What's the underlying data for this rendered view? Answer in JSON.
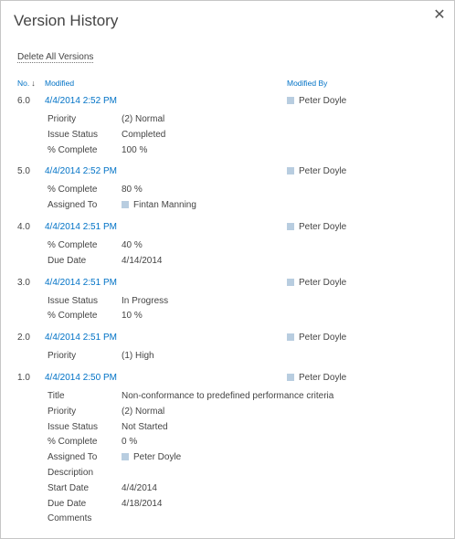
{
  "dialog": {
    "title": "Version History",
    "close_glyph": "✕",
    "delete_all_label": "Delete All Versions"
  },
  "columns": {
    "no": "No.",
    "sort_glyph": "↓",
    "modified": "Modified",
    "modified_by": "Modified By"
  },
  "colors": {
    "link": "#0072c6",
    "text": "#444444",
    "user_square": "#b8cde0"
  },
  "versions": [
    {
      "no": "6.0",
      "modified": "4/4/2014 2:52 PM",
      "modified_by": "Peter Doyle",
      "props": [
        {
          "label": "Priority",
          "value": "(2) Normal",
          "user": false
        },
        {
          "label": "Issue Status",
          "value": "Completed",
          "user": false
        },
        {
          "label": "% Complete",
          "value": "100 %",
          "user": false
        }
      ]
    },
    {
      "no": "5.0",
      "modified": "4/4/2014 2:52 PM",
      "modified_by": "Peter Doyle",
      "props": [
        {
          "label": "% Complete",
          "value": "80 %",
          "user": false
        },
        {
          "label": "Assigned To",
          "value": "Fintan Manning",
          "user": true
        }
      ]
    },
    {
      "no": "4.0",
      "modified": "4/4/2014 2:51 PM",
      "modified_by": "Peter Doyle",
      "props": [
        {
          "label": "% Complete",
          "value": "40 %",
          "user": false
        },
        {
          "label": "Due Date",
          "value": "4/14/2014",
          "user": false
        }
      ]
    },
    {
      "no": "3.0",
      "modified": "4/4/2014 2:51 PM",
      "modified_by": "Peter Doyle",
      "props": [
        {
          "label": "Issue Status",
          "value": "In Progress",
          "user": false
        },
        {
          "label": "% Complete",
          "value": "10 %",
          "user": false
        }
      ]
    },
    {
      "no": "2.0",
      "modified": "4/4/2014 2:51 PM",
      "modified_by": "Peter Doyle",
      "props": [
        {
          "label": "Priority",
          "value": "(1) High",
          "user": false
        }
      ]
    },
    {
      "no": "1.0",
      "modified": "4/4/2014 2:50 PM",
      "modified_by": "Peter Doyle",
      "props": [
        {
          "label": "Title",
          "value": "Non-conformance to predefined performance criteria",
          "user": false
        },
        {
          "label": "Priority",
          "value": "(2) Normal",
          "user": false
        },
        {
          "label": "Issue Status",
          "value": "Not Started",
          "user": false
        },
        {
          "label": "% Complete",
          "value": "0 %",
          "user": false
        },
        {
          "label": "Assigned To",
          "value": "Peter Doyle",
          "user": true
        },
        {
          "label": "Description",
          "value": "",
          "user": false
        },
        {
          "label": "Start Date",
          "value": "4/4/2014",
          "user": false
        },
        {
          "label": "Due Date",
          "value": "4/18/2014",
          "user": false
        },
        {
          "label": "Comments",
          "value": "",
          "user": false
        }
      ]
    }
  ]
}
